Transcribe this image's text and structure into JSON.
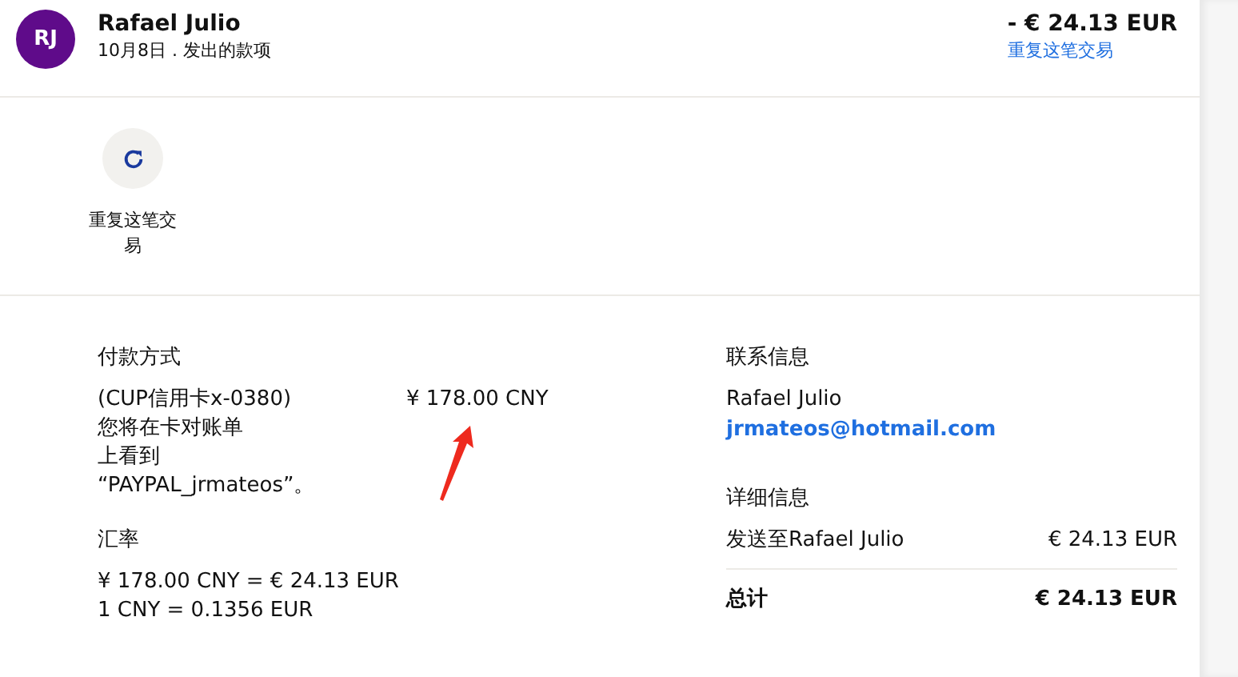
{
  "header": {
    "avatar": {
      "initials": "RJ",
      "color": "#5f0b8a"
    },
    "name": "Rafael Julio",
    "subtitle": "10月8日 . 发出的款项",
    "amount": "- € 24.13 EUR",
    "link": "重复这笔交易"
  },
  "action": {
    "label": "重复这笔交易"
  },
  "payment": {
    "heading": "付款方式",
    "method": "(CUP信用卡x-0380)",
    "amount": "¥ 178.00 CNY",
    "note": [
      "您将在卡对账单",
      "上看到",
      "“PAYPAL_jrmateos”。"
    ]
  },
  "exchange": {
    "heading": "汇率",
    "lines": [
      "¥ 178.00 CNY = € 24.13 EUR",
      "1 CNY = 0.1356 EUR"
    ]
  },
  "contact": {
    "heading": "联系信息",
    "name": "Rafael Julio",
    "email": "jrmateos@hotmail.com"
  },
  "details": {
    "heading": "详细信息",
    "rows": [
      {
        "label": "发送至Rafael Julio",
        "value": "€ 24.13 EUR",
        "kind": "line"
      },
      {
        "label": "总计",
        "value": "€ 24.13 EUR",
        "kind": "total"
      }
    ]
  }
}
